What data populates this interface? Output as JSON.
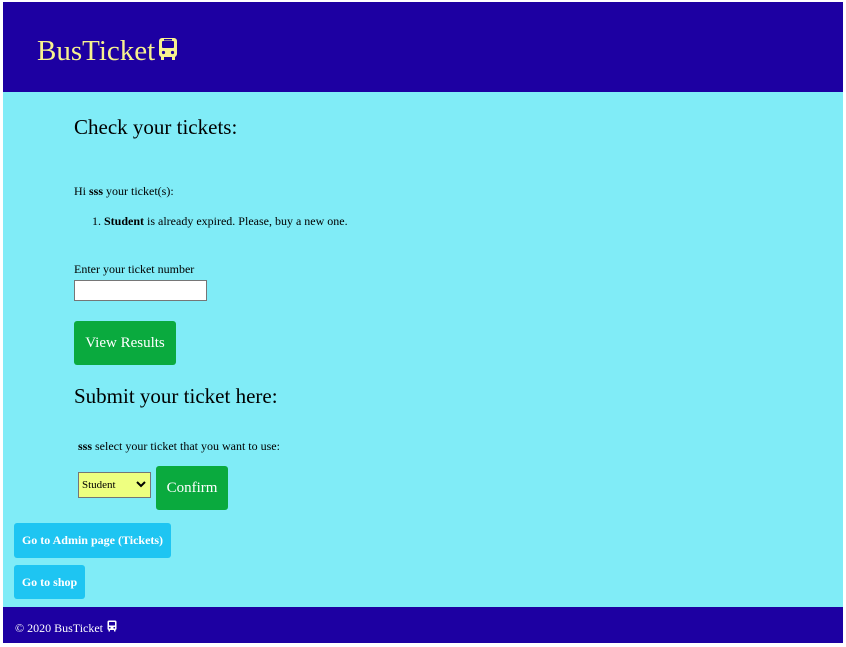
{
  "header": {
    "brand": "BusTicket",
    "brand_icon": "bus-icon",
    "colors": {
      "header_bg": "#1d00a2",
      "brand_text": "#f7f28e"
    }
  },
  "check_section": {
    "title": "Check your tickets:",
    "greeting_prefix": "Hi",
    "username": "sss",
    "greeting_suffix": "your ticket(s):",
    "tickets": [
      {
        "index": "1.",
        "name": "Student",
        "status": "is already expired. Please, buy a new one."
      }
    ],
    "input_label": "Enter your ticket number",
    "input_value": "",
    "input_placeholder": "",
    "view_button": "View Results"
  },
  "submit_section": {
    "title": "Submit your ticket here:",
    "username": "sss",
    "instruction": "select your ticket that you want to use:",
    "selected_ticket": "Student",
    "confirm_button": "Confirm"
  },
  "nav_buttons": {
    "admin": "Go to Admin page (Tickets)",
    "shop": "Go to shop"
  },
  "footer": {
    "text": "© 2020 BusTicket",
    "icon": "bus-icon"
  },
  "colors": {
    "page_bg": "#80ecf7",
    "green_button": "#0aaa3e",
    "cyan_button": "#1ec5f2",
    "select_bg": "#eeff80"
  }
}
